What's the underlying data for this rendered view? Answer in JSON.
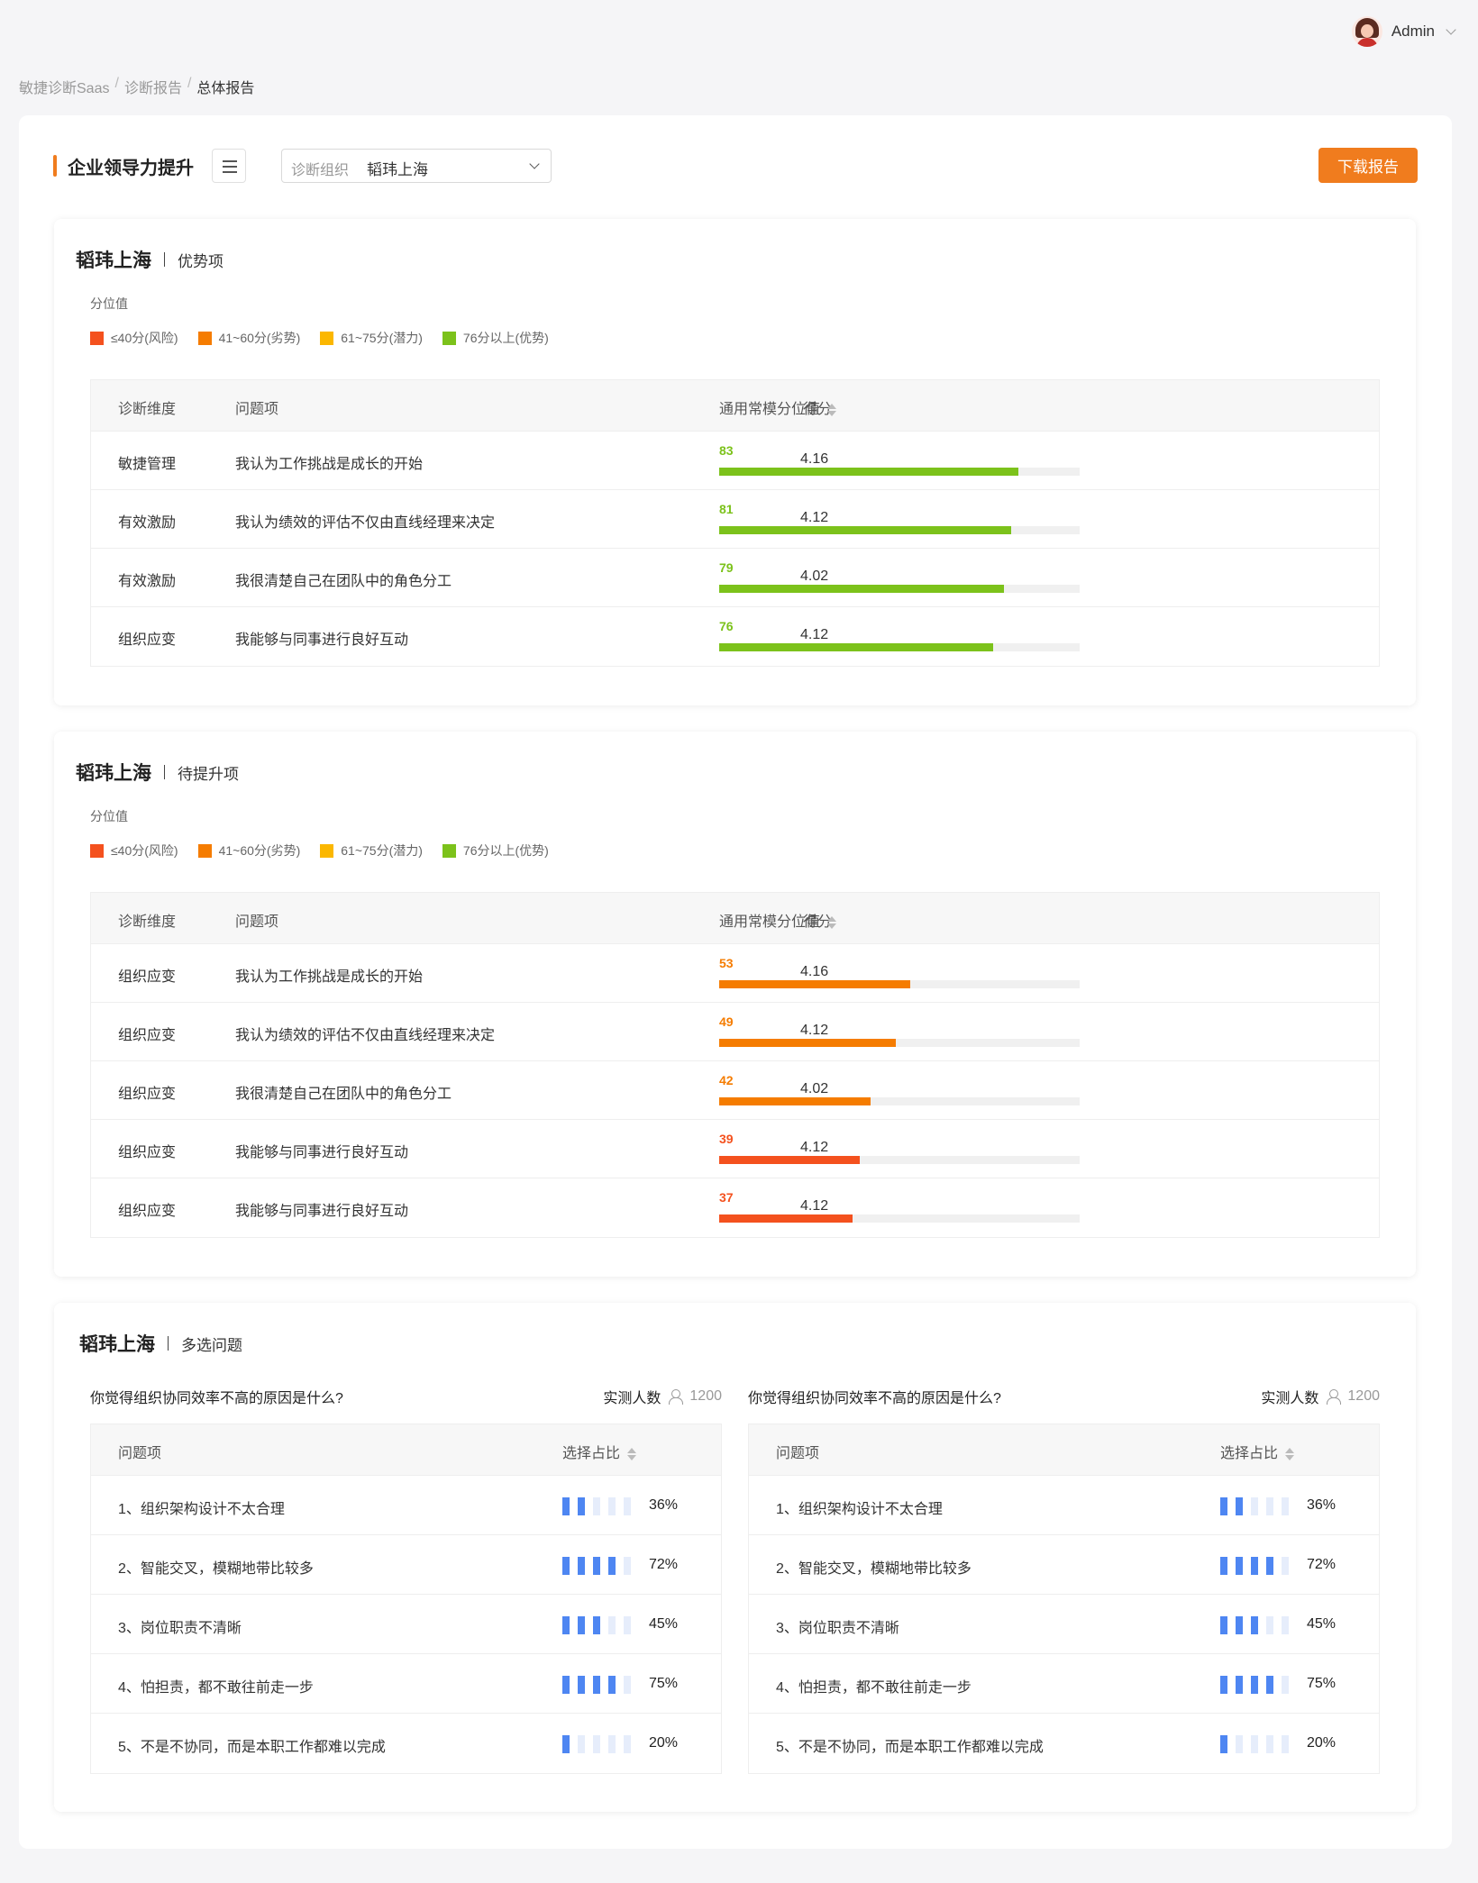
{
  "user": {
    "name": "Admin"
  },
  "breadcrumb": {
    "items": [
      "敏捷诊断Saas",
      "诊断报告",
      "总体报告"
    ]
  },
  "header": {
    "title": "企业领导力提升",
    "org_select": {
      "label": "诊断组织",
      "value": "韬玮上海"
    },
    "download_label": "下载报告"
  },
  "legend": {
    "title": "分位值",
    "items": [
      {
        "label": "≤40分(风险)",
        "color": "#f4511e"
      },
      {
        "label": "41~60分(劣势)",
        "color": "#f57c00"
      },
      {
        "label": "61~75分(潜力)",
        "color": "#fbb700"
      },
      {
        "label": "76分以上(优势)",
        "color": "#7cc21b"
      }
    ]
  },
  "columns": {
    "dimension": "诊断维度",
    "question": "问题项",
    "score": "得分",
    "percentile": "通用常模分位值"
  },
  "strengths": {
    "org": "韬玮上海",
    "subtitle": "优势项",
    "rows": [
      {
        "dimension": "敏捷管理",
        "question": "我认为工作挑战是成长的开始",
        "score": "4.16",
        "percentile": 83,
        "color": "#7cc21b"
      },
      {
        "dimension": "有效激励",
        "question": "我认为绩效的评估不仅由直线经理来决定",
        "score": "4.12",
        "percentile": 81,
        "color": "#7cc21b"
      },
      {
        "dimension": "有效激励",
        "question": "我很清楚自己在团队中的角色分工",
        "score": "4.02",
        "percentile": 79,
        "color": "#7cc21b"
      },
      {
        "dimension": "组织应变",
        "question": "我能够与同事进行良好互动",
        "score": "4.12",
        "percentile": 76,
        "color": "#7cc21b"
      }
    ]
  },
  "improvements": {
    "org": "韬玮上海",
    "subtitle": "待提升项",
    "rows": [
      {
        "dimension": "组织应变",
        "question": "我认为工作挑战是成长的开始",
        "score": "4.16",
        "percentile": 53,
        "color": "#f57c00"
      },
      {
        "dimension": "组织应变",
        "question": "我认为绩效的评估不仅由直线经理来决定",
        "score": "4.12",
        "percentile": 49,
        "color": "#f57c00"
      },
      {
        "dimension": "组织应变",
        "question": "我很清楚自己在团队中的角色分工",
        "score": "4.02",
        "percentile": 42,
        "color": "#f57c00"
      },
      {
        "dimension": "组织应变",
        "question": "我能够与同事进行良好互动",
        "score": "4.12",
        "percentile": 39,
        "color": "#f4511e"
      },
      {
        "dimension": "组织应变",
        "question": "我能够与同事进行良好互动",
        "score": "4.12",
        "percentile": 37,
        "color": "#f4511e"
      }
    ]
  },
  "multi": {
    "org": "韬玮上海",
    "subtitle": "多选问题",
    "panels": [
      {
        "question": "你觉得组织协同效率不高的原因是什么?",
        "count_label": "实测人数",
        "count": "1200",
        "col_item": "问题项",
        "col_ratio": "选择占比",
        "rows": [
          {
            "item": "1、组织架构设计不太合理",
            "pct": "36%",
            "filled": 2
          },
          {
            "item": "2、智能交叉，模糊地带比较多",
            "pct": "72%",
            "filled": 4
          },
          {
            "item": "3、岗位职责不清晰",
            "pct": "45%",
            "filled": 3
          },
          {
            "item": "4、怕担责，都不敢往前走一步",
            "pct": "75%",
            "filled": 4
          },
          {
            "item": "5、不是不协同，而是本职工作都难以完成",
            "pct": "20%",
            "filled": 1
          }
        ]
      },
      {
        "question": "你觉得组织协同效率不高的原因是什么?",
        "count_label": "实测人数",
        "count": "1200",
        "col_item": "问题项",
        "col_ratio": "选择占比",
        "rows": [
          {
            "item": "1、组织架构设计不太合理",
            "pct": "36%",
            "filled": 2
          },
          {
            "item": "2、智能交叉，模糊地带比较多",
            "pct": "72%",
            "filled": 4
          },
          {
            "item": "3、岗位职责不清晰",
            "pct": "45%",
            "filled": 3
          },
          {
            "item": "4、怕担责，都不敢往前走一步",
            "pct": "75%",
            "filled": 4
          },
          {
            "item": "5、不是不协同，而是本职工作都难以完成",
            "pct": "20%",
            "filled": 1
          }
        ]
      }
    ]
  }
}
